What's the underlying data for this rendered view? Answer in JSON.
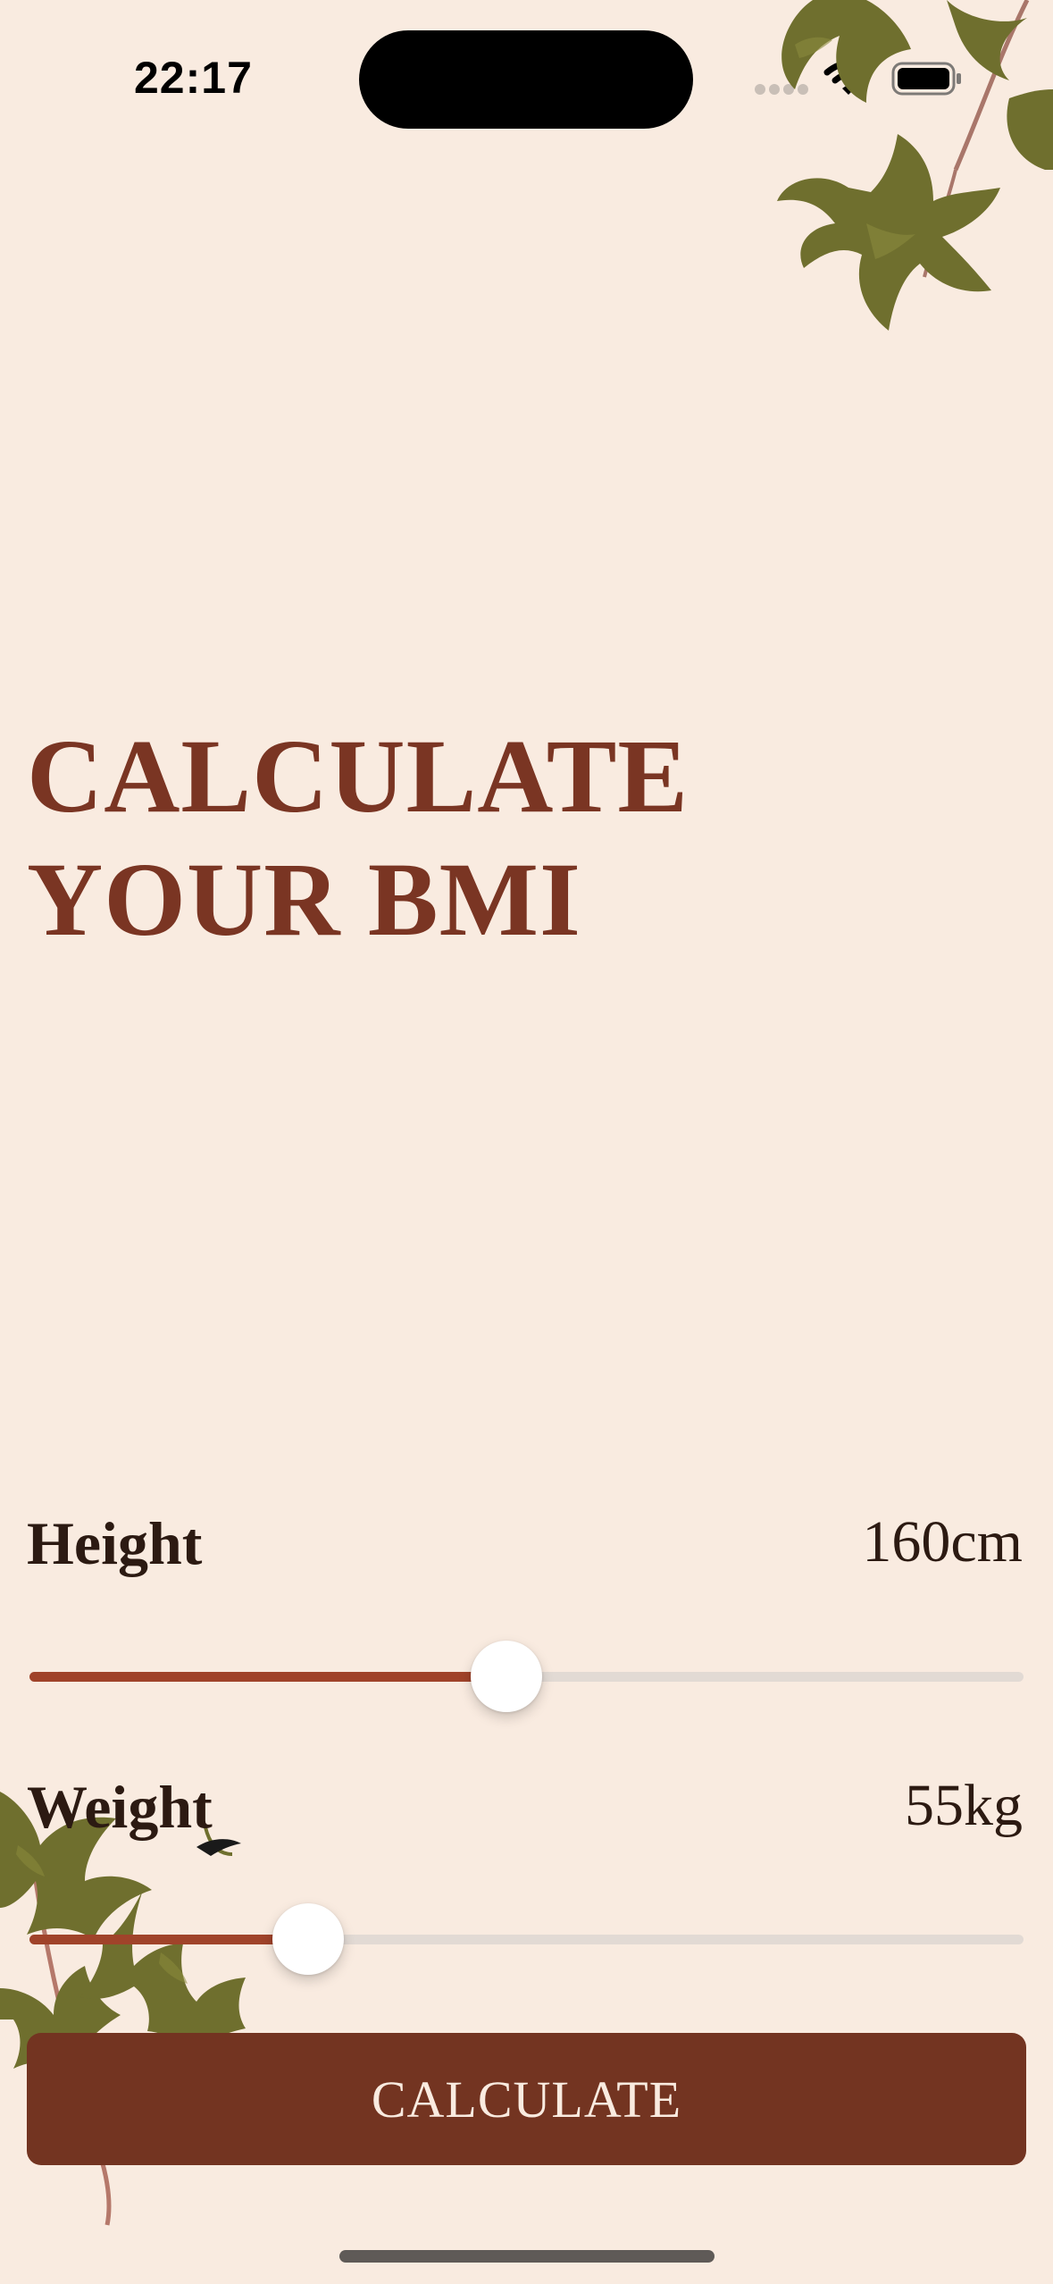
{
  "status_bar": {
    "time": "22:17",
    "icons": [
      "cellular-signal-icon",
      "wifi-icon",
      "battery-icon"
    ]
  },
  "title": {
    "line1": "CALCULATE",
    "line2": "YOUR BMI"
  },
  "height": {
    "label": "Height",
    "value": "160cm",
    "slider_fraction": 0.48
  },
  "weight": {
    "label": "Weight",
    "value": "55kg",
    "slider_fraction": 0.28
  },
  "button": {
    "label": "CALCULATE"
  },
  "colors": {
    "background": "#f9ebe0",
    "accent": "#733421",
    "title": "#7a3523",
    "slider_fill": "#a0432a",
    "slider_track": "#e2dad4",
    "leaf": "#6b6a2c"
  },
  "decorations": [
    "leaves-top-right",
    "leaves-bottom-left"
  ]
}
